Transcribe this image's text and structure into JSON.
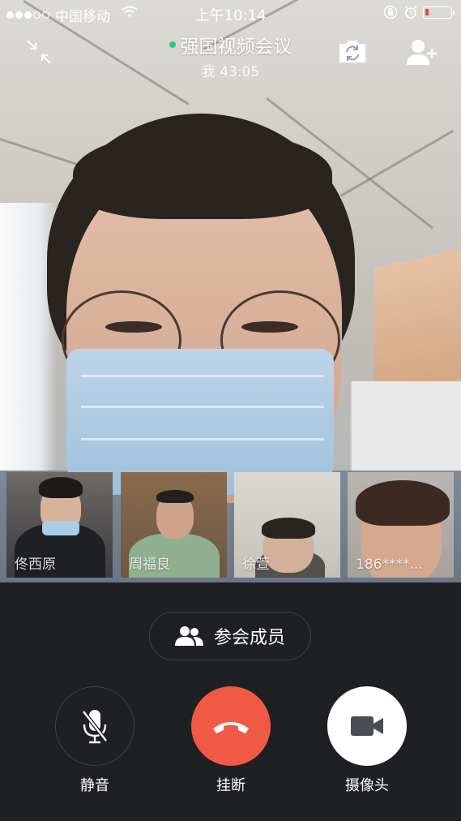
{
  "status_bar": {
    "signal_dots_filled": 3,
    "signal_dots_total": 5,
    "carrier": "中国移动",
    "time": "上午10:14",
    "battery_level": 0.12,
    "icons": [
      "wifi-icon",
      "rotation-lock-icon",
      "alarm-icon",
      "battery-icon"
    ]
  },
  "header": {
    "meeting_title": "强国视频会议",
    "speaker_line": "我 43:05",
    "icons": [
      "minimize-icon",
      "switch-camera-icon",
      "add-member-icon"
    ]
  },
  "participants": [
    {
      "name": "佟西原"
    },
    {
      "name": "周福良"
    },
    {
      "name": "徐萱"
    },
    {
      "name": "186****..."
    }
  ],
  "members_button": {
    "label": "参会成员",
    "icon": "members-icon"
  },
  "controls": {
    "mute": {
      "label": "静音",
      "icon": "mic-off-icon"
    },
    "hangup": {
      "label": "挂断",
      "icon": "hangup-icon"
    },
    "camera": {
      "label": "摄像头",
      "icon": "video-camera-icon"
    }
  },
  "colors": {
    "panel_bg": "#1e2024",
    "hangup_red": "#f05a44",
    "live_dot": "#2ecc71",
    "battery_low": "#ff3b30"
  }
}
